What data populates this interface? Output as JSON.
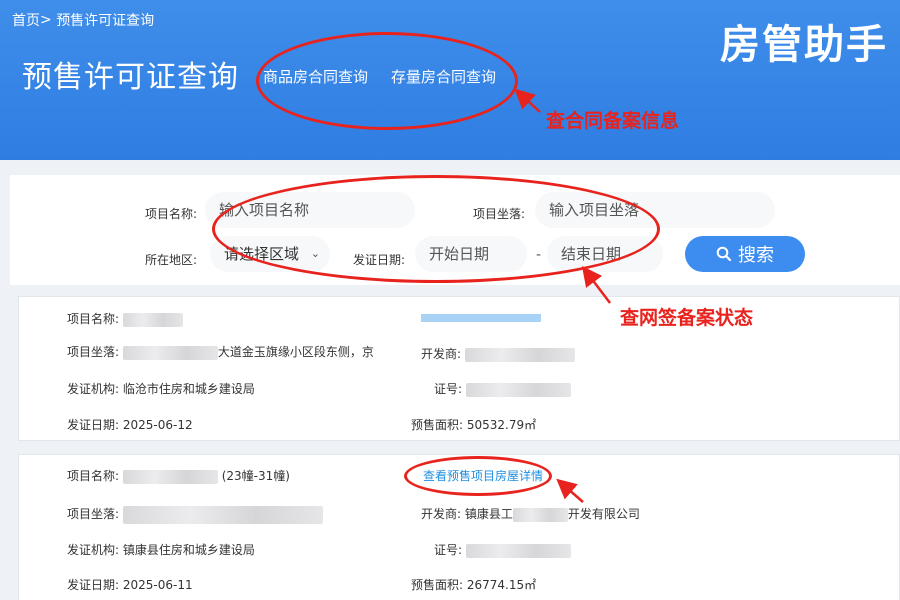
{
  "header": {
    "breadcrumb": {
      "home": "首页",
      "sep": ">",
      "current": "预售许可证查询"
    },
    "page_title": "预售许可证查询",
    "nav": [
      "商品房合同查询",
      "存量房合同查询"
    ],
    "brand": "房管助手"
  },
  "annotations": {
    "contract_info": "查合同备案信息",
    "signing_status": "查网签备案状态"
  },
  "search": {
    "project_name": {
      "label": "项目名称:",
      "placeholder": "输入项目名称"
    },
    "project_location": {
      "label": "项目坐落:",
      "placeholder": "输入项目坐落"
    },
    "region": {
      "label": "所在地区:",
      "value": "请选择区域"
    },
    "issue_date": {
      "label": "发证日期:",
      "start_placeholder": "开始日期",
      "end_placeholder": "结束日期",
      "separator": "-"
    },
    "button": "搜索"
  },
  "results": [
    {
      "name_label": "项目名称:",
      "location_label": "项目坐落:",
      "location_visible": "大道金玉旗缘小区段东侧，京",
      "developer_label": "开发商:",
      "authority_label": "发证机构:",
      "authority": "临沧市住房和城乡建设局",
      "cert_label": "证号:",
      "date_label": "发证日期:",
      "date": "2025-06-12",
      "area_label": "预售面积:",
      "area": "50532.79㎡"
    },
    {
      "name_label": "项目名称:",
      "name_suffix": "(23幢-31幢)",
      "detail_link": "查看预售项目房屋详情",
      "location_label": "项目坐落:",
      "developer_label": "开发商:",
      "developer_prefix": "镇康县工",
      "developer_suffix": "开发有限公司",
      "authority_label": "发证机构:",
      "authority": "镇康县住房和城乡建设局",
      "cert_label": "证号:",
      "date_label": "发证日期:",
      "date": "2025-06-11",
      "area_label": "预售面积:",
      "area": "26774.15㎡"
    }
  ],
  "colors": {
    "header": "#2f7de2",
    "button": "#3d8df0",
    "annotation": "#e8231d",
    "link": "#1f8fe0"
  }
}
